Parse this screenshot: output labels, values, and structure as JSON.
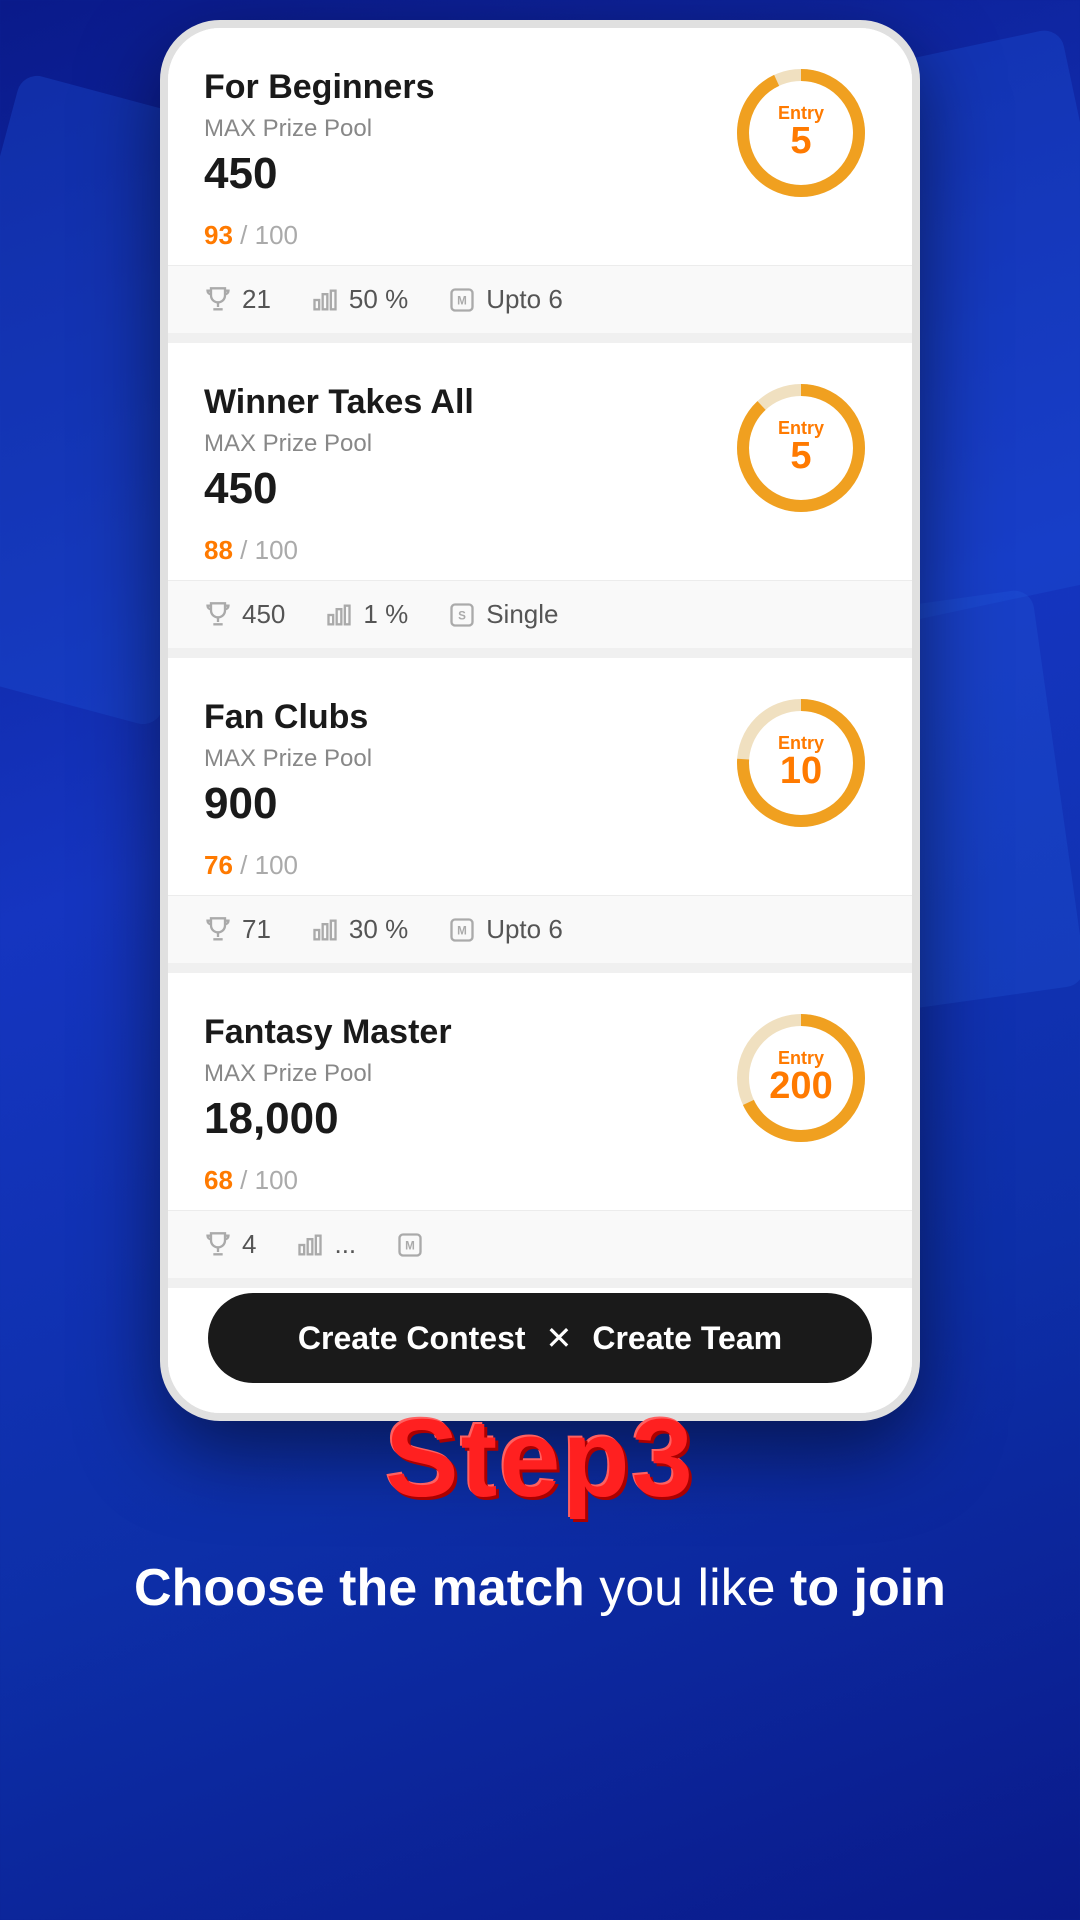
{
  "background": {
    "color1": "#0a1a8a",
    "color2": "#1535c0"
  },
  "step": {
    "title": "Step3",
    "subtitle_bold1": "Choose the match",
    "subtitle_normal": " you like ",
    "subtitle_bold2": "to join"
  },
  "bottomBar": {
    "createContest": "Create Contest",
    "separator": "✕",
    "createTeam": "Create Team"
  },
  "cards": [
    {
      "id": "beginners",
      "title": "For Beginners",
      "prizeLabel": "MAX Prize Pool",
      "prizeAmount": "450",
      "entry": "5",
      "filled": 93,
      "total": 100,
      "filledText": "93",
      "totalText": "/ 100",
      "stats": [
        {
          "icon": "trophy",
          "value": "21"
        },
        {
          "icon": "bar-chart",
          "value": "50 %"
        },
        {
          "icon": "badge-m",
          "value": "Upto 6"
        }
      ],
      "fillPercent": 93
    },
    {
      "id": "winner-takes-all",
      "title": "Winner Takes All",
      "prizeLabel": "MAX Prize Pool",
      "prizeAmount": "450",
      "entry": "5",
      "filled": 88,
      "total": 100,
      "filledText": "88",
      "totalText": "/ 100",
      "stats": [
        {
          "icon": "trophy",
          "value": "450"
        },
        {
          "icon": "bar-chart",
          "value": "1 %"
        },
        {
          "icon": "badge-s",
          "value": "Single"
        }
      ],
      "fillPercent": 88
    },
    {
      "id": "fan-clubs",
      "title": "Fan Clubs",
      "prizeLabel": "MAX Prize Pool",
      "prizeAmount": "900",
      "entry": "10",
      "filled": 76,
      "total": 100,
      "filledText": "76",
      "totalText": "/ 100",
      "stats": [
        {
          "icon": "trophy",
          "value": "71"
        },
        {
          "icon": "bar-chart",
          "value": "30 %"
        },
        {
          "icon": "badge-m",
          "value": "Upto 6"
        }
      ],
      "fillPercent": 76
    },
    {
      "id": "fantasy-master",
      "title": "Fantasy Master",
      "prizeLabel": "MAX Prize Pool",
      "prizeAmount": "18,000",
      "entry": "200",
      "filled": 68,
      "total": 100,
      "filledText": "68",
      "totalText": "/ 100",
      "stats": [
        {
          "icon": "trophy",
          "value": "4"
        },
        {
          "icon": "bar-chart",
          "value": "..."
        },
        {
          "icon": "badge-m",
          "value": ""
        }
      ],
      "fillPercent": 68
    }
  ]
}
